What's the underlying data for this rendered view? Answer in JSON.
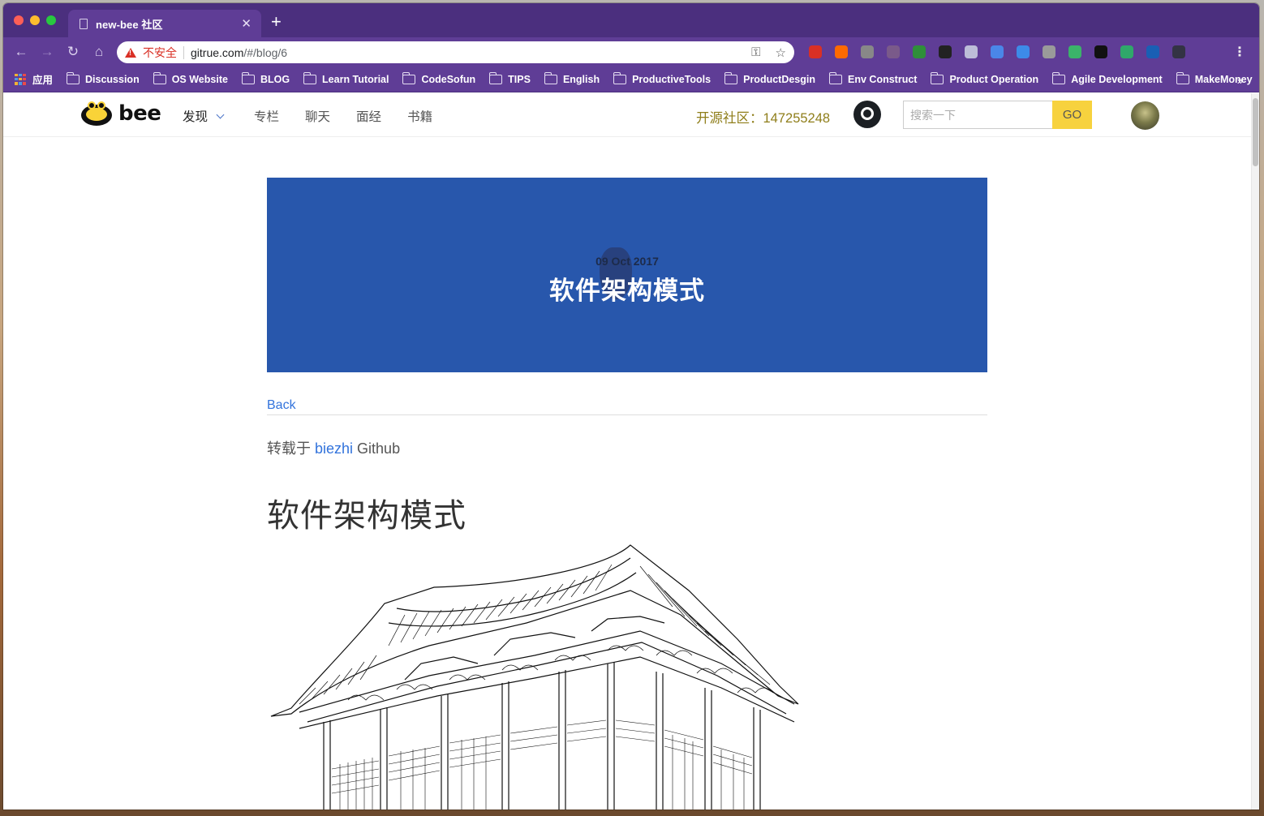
{
  "browser": {
    "tab_title": "new-bee 社区",
    "new_tab": "+",
    "tab_close": "✕",
    "security_label": "不安全",
    "url_host": "gitrue.com",
    "url_path": "/#/blog/6",
    "bookmarks": [
      {
        "label": "应用",
        "icon": "apps-icon"
      },
      {
        "label": "Discussion",
        "icon": "folder-icon"
      },
      {
        "label": "OS Website",
        "icon": "folder-icon"
      },
      {
        "label": "BLOG",
        "icon": "folder-icon"
      },
      {
        "label": "Learn Tutorial",
        "icon": "folder-icon"
      },
      {
        "label": "CodeSofun",
        "icon": "folder-icon"
      },
      {
        "label": "TIPS",
        "icon": "folder-icon"
      },
      {
        "label": "English",
        "icon": "folder-icon"
      },
      {
        "label": "ProductiveTools",
        "icon": "folder-icon"
      },
      {
        "label": "ProductDesgin",
        "icon": "folder-icon"
      },
      {
        "label": "Env Construct",
        "icon": "folder-icon"
      },
      {
        "label": "Product Operation",
        "icon": "folder-icon"
      },
      {
        "label": "Agile Development",
        "icon": "folder-icon"
      },
      {
        "label": "MakeMoney",
        "icon": "folder-icon"
      }
    ],
    "bookmarks_overflow": "»",
    "extension_colors": [
      "#d93025",
      "#ff6a00",
      "#888888",
      "#7a5a8a",
      "#2f8f3a",
      "#222222",
      "#bdbdd8",
      "#4a86e8",
      "#3d8be8",
      "#9a9a9a",
      "#3bb36a",
      "#111111",
      "#2fa86a",
      "#1a5fb4",
      "#333344"
    ]
  },
  "site": {
    "logo_text": "bee",
    "nav": {
      "discover": "发现",
      "items": [
        "专栏",
        "聊天",
        "面经",
        "书籍"
      ]
    },
    "community": "开源社区：147255248",
    "search_placeholder": "搜索一下",
    "search_button": "GO"
  },
  "article": {
    "date": "09 Oct 2017",
    "banner_title": "软件架构模式",
    "back": "Back",
    "source_prefix": "转载于 ",
    "source_author": "biezhi",
    "source_suffix": " Github",
    "title": "软件架构模式"
  },
  "colors": {
    "browser_frame": "#4b2f7e",
    "toolbar": "#5f3d96",
    "banner": "#2857ac",
    "link": "#3273dc",
    "search_button": "#f7d23e",
    "community_text": "#8f7e1a"
  }
}
